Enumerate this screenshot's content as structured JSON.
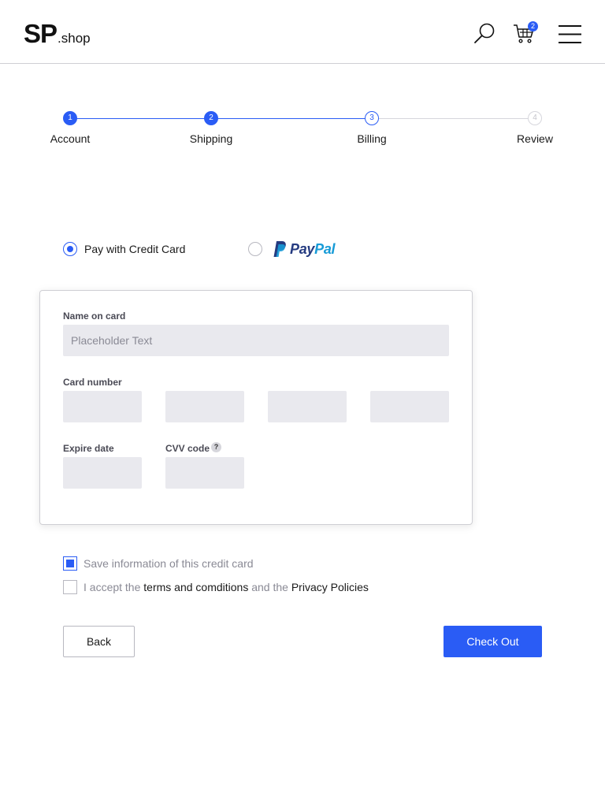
{
  "header": {
    "logo_main": "SP",
    "logo_sub": ".shop",
    "cart_count": "2",
    "icons": [
      "search-icon",
      "cart-icon",
      "menu-icon"
    ]
  },
  "stepper": {
    "steps": [
      {
        "number": "1",
        "label": "Account",
        "state": "completed"
      },
      {
        "number": "2",
        "label": "Shipping",
        "state": "completed"
      },
      {
        "number": "3",
        "label": "Billing",
        "state": "current"
      },
      {
        "number": "4",
        "label": "Review",
        "state": "upcoming"
      }
    ]
  },
  "payment": {
    "credit_card_label": "Pay with Credit Card",
    "credit_card_selected": true,
    "paypal_pay": "Pay",
    "paypal_pal": "Pal",
    "paypal_selected": false
  },
  "card_form": {
    "name_label": "Name on card",
    "name_placeholder": "Placeholder Text",
    "number_label": "Card number",
    "expire_label": "Expire date",
    "cvv_label": "CVV code",
    "cvv_help": "?"
  },
  "options": {
    "save_info_label": "Save information of this credit card",
    "save_info_checked": true,
    "accept_prefix": "I accept the",
    "terms_link": "terms and comditions",
    "accept_middle": "and the",
    "privacy_link": "Privacy Policies",
    "accept_checked": false
  },
  "buttons": {
    "back": "Back",
    "checkout": "Check Out"
  },
  "colors": {
    "accent": "#2a5cf5",
    "field_bg": "#e9e9ee",
    "muted_text": "#8a8a95"
  }
}
